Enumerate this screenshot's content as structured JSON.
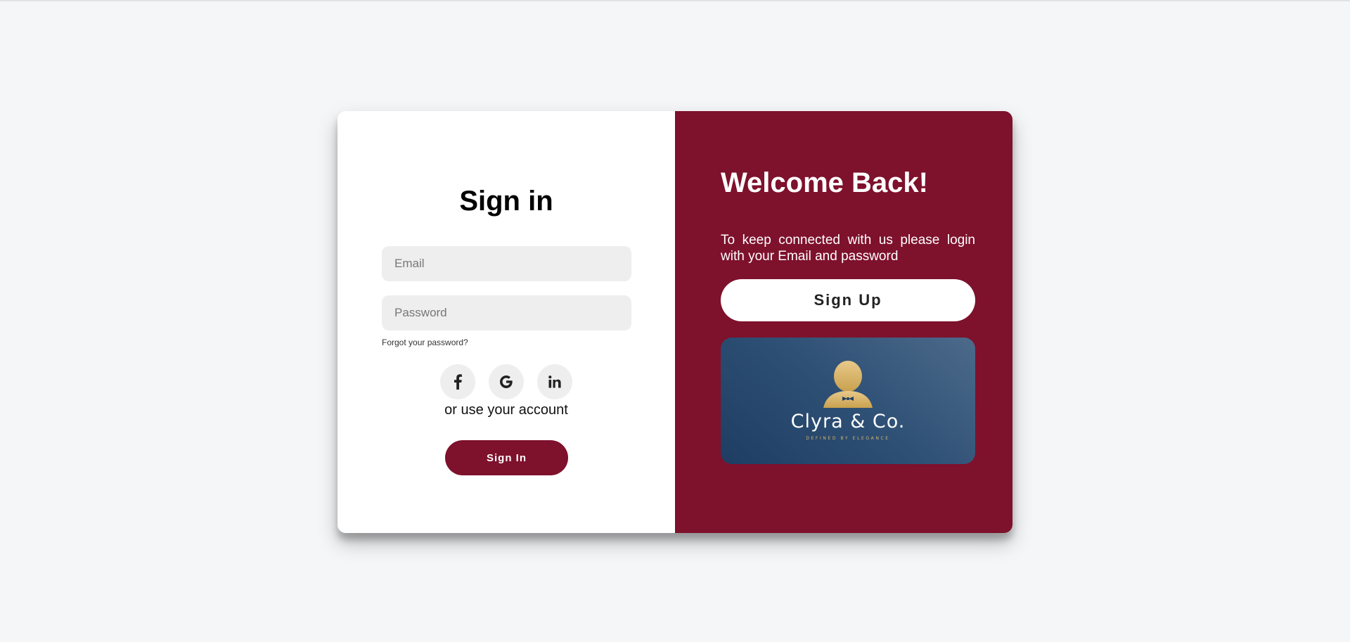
{
  "signin": {
    "title": "Sign in",
    "email_placeholder": "Email",
    "password_placeholder": "Password",
    "forgot_link": "Forgot your password?",
    "socials": [
      "facebook-icon",
      "google-icon",
      "linkedin-icon"
    ],
    "alt_text": "or use your account",
    "button_label": "Sign In"
  },
  "welcome": {
    "title": "Welcome Back!",
    "text": "To keep connected with us please login with your Email and password",
    "signup_label": "Sign Up"
  },
  "logo": {
    "brand_name": "Clyra & Co.",
    "tagline": "DEFINED BY ELEGANCE"
  },
  "colors": {
    "accent": "#7e112c",
    "page_bg": "#f5f6f8",
    "field_bg": "#eeeeee",
    "logo_gold": "#d8b66a",
    "logo_bg": "#2e5075"
  }
}
